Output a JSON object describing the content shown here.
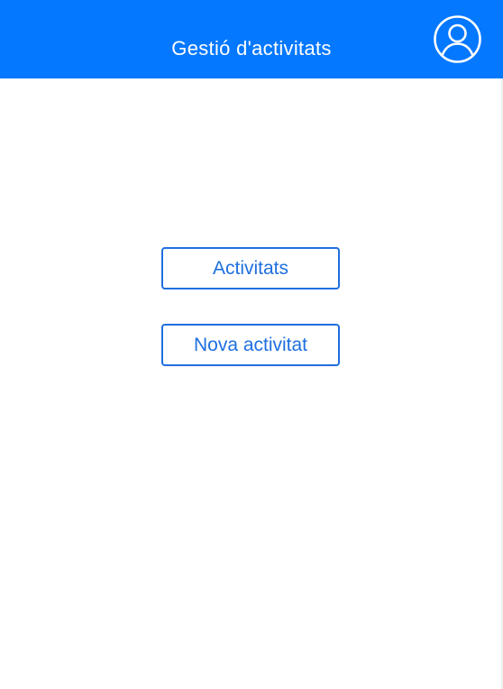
{
  "header": {
    "title": "Gestió d'activitats",
    "background_color": "#0478ff",
    "profile_icon": "user-circle-icon"
  },
  "menu": {
    "activities_label": "Activitats",
    "new_activity_label": "Nova activitat",
    "accent_color": "#1e6fe0"
  }
}
